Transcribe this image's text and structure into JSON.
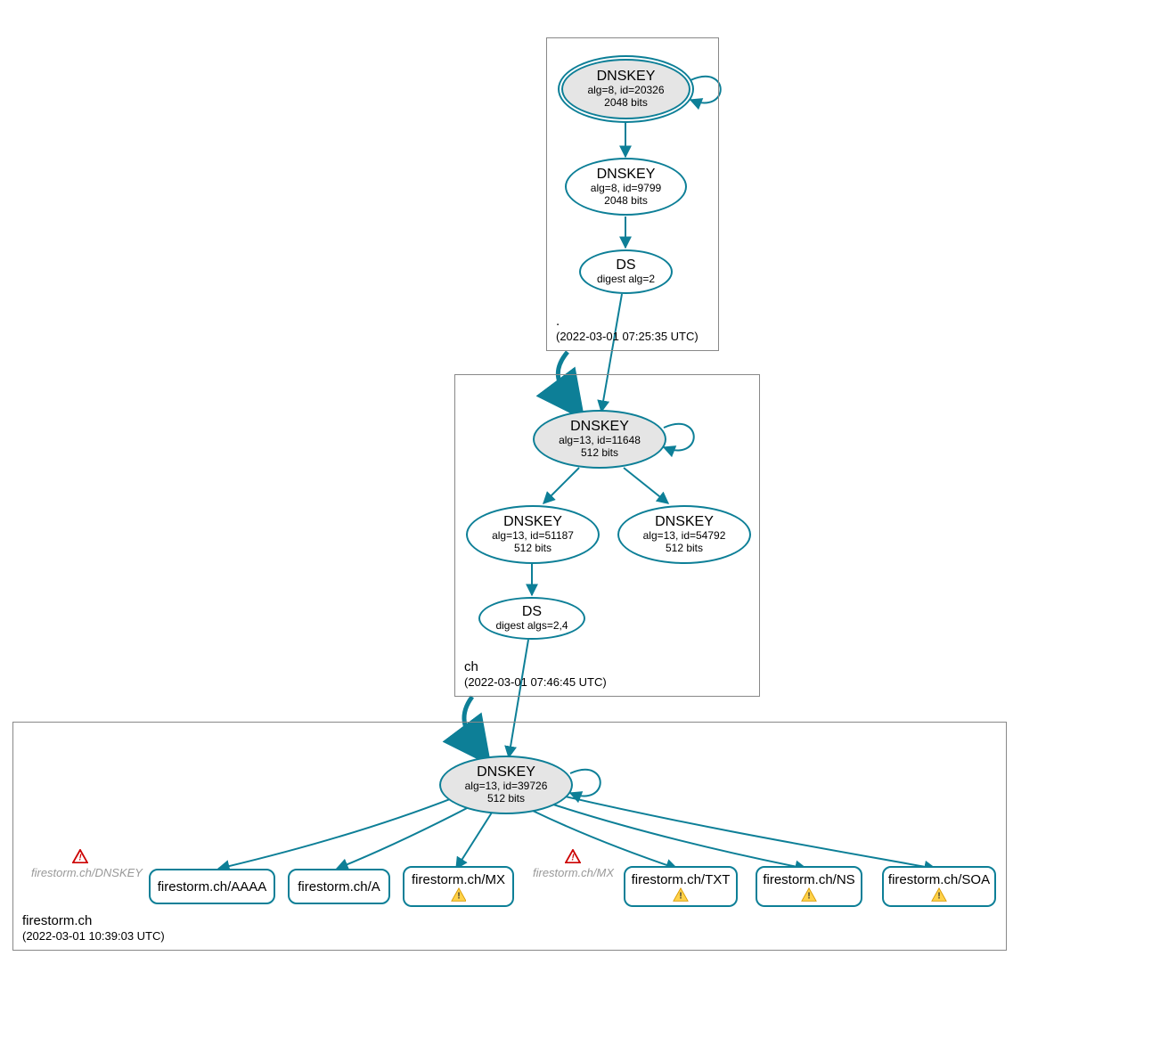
{
  "colors": {
    "stroke": "#0d7f97",
    "fill_grey": "#e5e5e5",
    "ghost": "#999"
  },
  "zones": {
    "root": {
      "name": ".",
      "time": "(2022-03-01 07:25:35 UTC)"
    },
    "ch": {
      "name": "ch",
      "time": "(2022-03-01 07:46:45 UTC)"
    },
    "firestorm": {
      "name": "firestorm.ch",
      "time": "(2022-03-01 10:39:03 UTC)"
    }
  },
  "nodes": {
    "root_ksk": {
      "l1": "DNSKEY",
      "l2": "alg=8, id=20326",
      "l3": "2048 bits"
    },
    "root_zsk": {
      "l1": "DNSKEY",
      "l2": "alg=8, id=9799",
      "l3": "2048 bits"
    },
    "root_ds": {
      "l1": "DS",
      "l2": "digest alg=2"
    },
    "ch_ksk": {
      "l1": "DNSKEY",
      "l2": "alg=13, id=11648",
      "l3": "512 bits"
    },
    "ch_zsk1": {
      "l1": "DNSKEY",
      "l2": "alg=13, id=51187",
      "l3": "512 bits"
    },
    "ch_zsk2": {
      "l1": "DNSKEY",
      "l2": "alg=13, id=54792",
      "l3": "512 bits"
    },
    "ch_ds": {
      "l1": "DS",
      "l2": "digest algs=2,4"
    },
    "fs_ksk": {
      "l1": "DNSKEY",
      "l2": "alg=13, id=39726",
      "l3": "512 bits"
    }
  },
  "records": {
    "aaaa": {
      "label": "firestorm.ch/AAAA"
    },
    "a": {
      "label": "firestorm.ch/A"
    },
    "mx": {
      "label": "firestorm.ch/MX"
    },
    "txt": {
      "label": "firestorm.ch/TXT"
    },
    "ns": {
      "label": "firestorm.ch/NS"
    },
    "soa": {
      "label": "firestorm.ch/SOA"
    }
  },
  "ghosts": {
    "dnskey": {
      "label": "firestorm.ch/DNSKEY"
    },
    "mx": {
      "label": "firestorm.ch/MX"
    }
  }
}
